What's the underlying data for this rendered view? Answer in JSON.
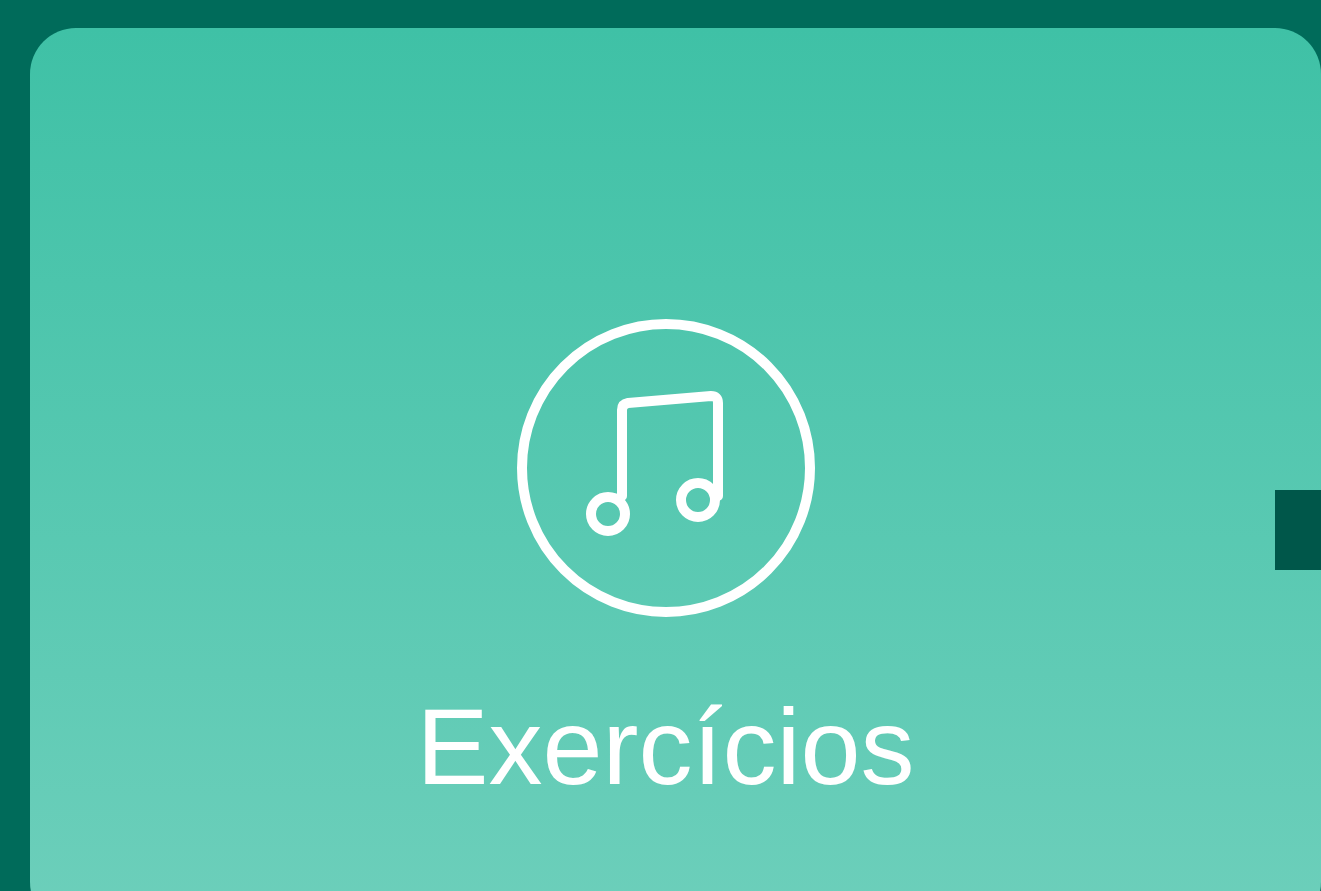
{
  "tile": {
    "label": "Exercícios"
  }
}
